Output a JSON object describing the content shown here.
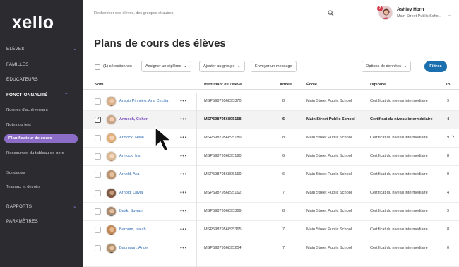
{
  "app": {
    "logo": "xello"
  },
  "sidebar": {
    "items": [
      {
        "label": "ÉLÈVES",
        "has_chevron": true
      },
      {
        "label": "FAMILLES"
      },
      {
        "label": "ÉDUCATEURS"
      },
      {
        "label": "FONCTIONNALITÉ",
        "has_chevron": true,
        "expanded": true
      },
      {
        "label": "Normes d'achèvement"
      },
      {
        "label": "Notes du test"
      },
      {
        "label": "Planificateur de cours",
        "active": true
      },
      {
        "label": "Ressources du tableau de bord"
      },
      {
        "label": "Sondages"
      },
      {
        "label": "Travaux et devoirs"
      },
      {
        "label": "RAPPORTS",
        "has_chevron": true
      },
      {
        "label": "PARAMÈTRES"
      }
    ]
  },
  "topbar": {
    "search_placeholder": "Rechercher des élèves, des groupes et autres",
    "notification_count": "7",
    "user_name": "Ashley Horn",
    "user_school": "Main Street Public Scho..."
  },
  "main": {
    "title": "Plans de cours des élèves",
    "toolbar": {
      "selected_label": "(1) sélectionnés",
      "assign_label": "Assigner un diplôme",
      "add_group_label": "Ajouter au groupe",
      "message_label": "Envoyer un message",
      "data_options_label": "Options de données",
      "filter_label": "Filtres"
    },
    "table": {
      "headers": {
        "name": "Nom",
        "id": "Identifiant de l'élève",
        "year": "Année",
        "school": "École",
        "diploma": "Diplôme",
        "to": "To"
      },
      "rows": [
        {
          "name": "Araujo Pinheiro, Ana Cecilia",
          "id": "MSP5987956895370",
          "year": "8",
          "school": "Main Street Public School",
          "diploma": "Certificat du niveau intermédiaire",
          "to": "9",
          "selected": false
        },
        {
          "name": "Armock, Cohen",
          "id": "MSP5987956895158",
          "year": "6",
          "school": "Main Street Public School",
          "diploma": "Certificat du niveau intermédiaire",
          "to": "4",
          "selected": true
        },
        {
          "name": "Armock, Halle",
          "id": "MSP5987956895189",
          "year": "8",
          "school": "Main Street Public School",
          "diploma": "Certificat du niveau intermédiaire",
          "to": "9",
          "selected": false
        },
        {
          "name": "Armock, Iris",
          "id": "MSP5987956895190",
          "year": "6",
          "school": "Main Street Public School",
          "diploma": "Certificat du niveau intermédiaire",
          "to": "8",
          "selected": false
        },
        {
          "name": "Arnold, Ava",
          "id": "MSP5987956895159",
          "year": "6",
          "school": "Main Street Public School",
          "diploma": "Certificat du niveau intermédiaire",
          "to": "9",
          "selected": false
        },
        {
          "name": "Arnold, Olivia",
          "id": "MSP5987956895162",
          "year": "7",
          "school": "Main Street Public School",
          "diploma": "Certificat du niveau intermédiaire",
          "to": "4",
          "selected": false
        },
        {
          "name": "Bask, Suwan",
          "id": "MSP5987956895369",
          "year": "8",
          "school": "Main Street Public School",
          "diploma": "Certificat du niveau intermédiaire",
          "to": "9",
          "selected": false
        },
        {
          "name": "Barnum, Isaiah",
          "id": "MSP5987956895365",
          "year": "7",
          "school": "Main Street Public School",
          "diploma": "Certificat du niveau intermédiaire",
          "to": "8",
          "selected": false
        },
        {
          "name": "Baumgart, Angel",
          "id": "MSP5987956895204",
          "year": "7",
          "school": "Main Street Public School",
          "diploma": "Certificat du niveau intermédiaire",
          "to": "0",
          "selected": false
        }
      ]
    }
  },
  "colors": {
    "sidebar_bg": "#2b2b30",
    "accent_purple": "#8b6cc6",
    "primary_blue": "#1b6fae",
    "link_blue": "#2f6db3"
  }
}
